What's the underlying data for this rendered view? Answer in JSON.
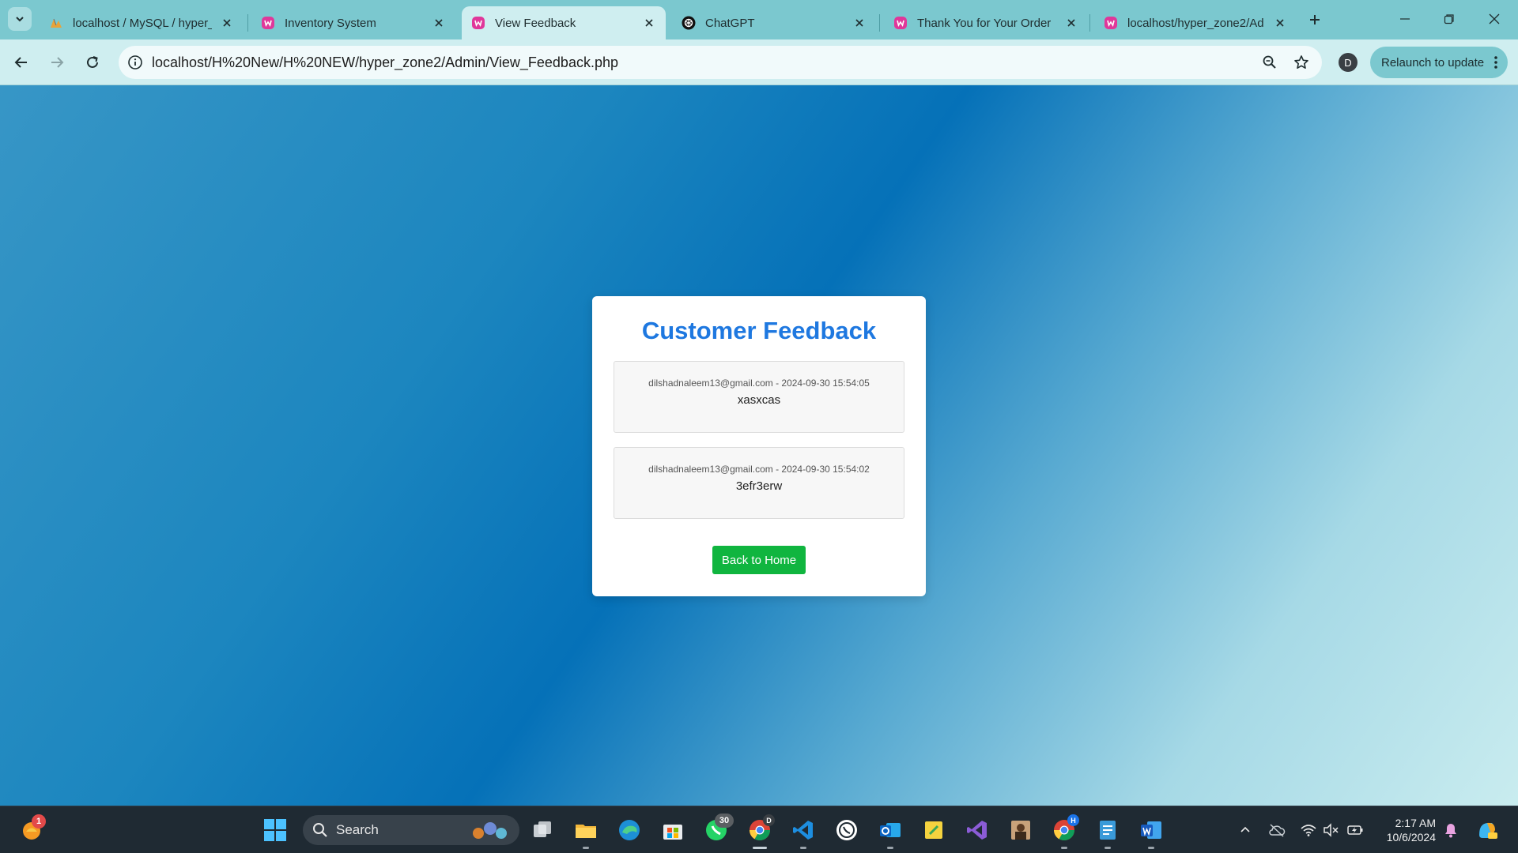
{
  "browser": {
    "tabs": [
      {
        "title": "localhost / MySQL / hyper_",
        "favicon": "phpmyadmin-icon",
        "active": false
      },
      {
        "title": "Inventory System",
        "favicon": "wamp-icon",
        "active": false
      },
      {
        "title": "View Feedback",
        "favicon": "wamp-icon",
        "active": true
      },
      {
        "title": "ChatGPT",
        "favicon": "chatgpt-icon",
        "active": false
      },
      {
        "title": "Thank You for Your Order",
        "favicon": "wamp-icon",
        "active": false
      },
      {
        "title": "localhost/hyper_zone2/Ad",
        "favicon": "wamp-icon",
        "active": false
      }
    ],
    "url": "localhost/H%20New/H%20NEW/hyper_zone2/Admin/View_Feedback.php",
    "profile_initial": "D",
    "relaunch_label": "Relaunch to update"
  },
  "page": {
    "title": "Customer Feedback",
    "feedback": [
      {
        "meta": "dilshadnaleem13@gmail.com - 2024-09-30 15:54:05",
        "message": "xasxcas"
      },
      {
        "meta": "dilshadnaleem13@gmail.com - 2024-09-30 15:54:02",
        "message": "3efr3erw"
      }
    ],
    "back_button": "Back to Home",
    "colors": {
      "title": "#1e78e0",
      "button": "#10b53f"
    }
  },
  "taskbar": {
    "search_label": "Search",
    "widget_badge": "1",
    "whatsapp_badge": "30",
    "chrome_badge": "D",
    "chrome2_badge": "H",
    "time": "2:17 AM",
    "date": "10/6/2024"
  }
}
